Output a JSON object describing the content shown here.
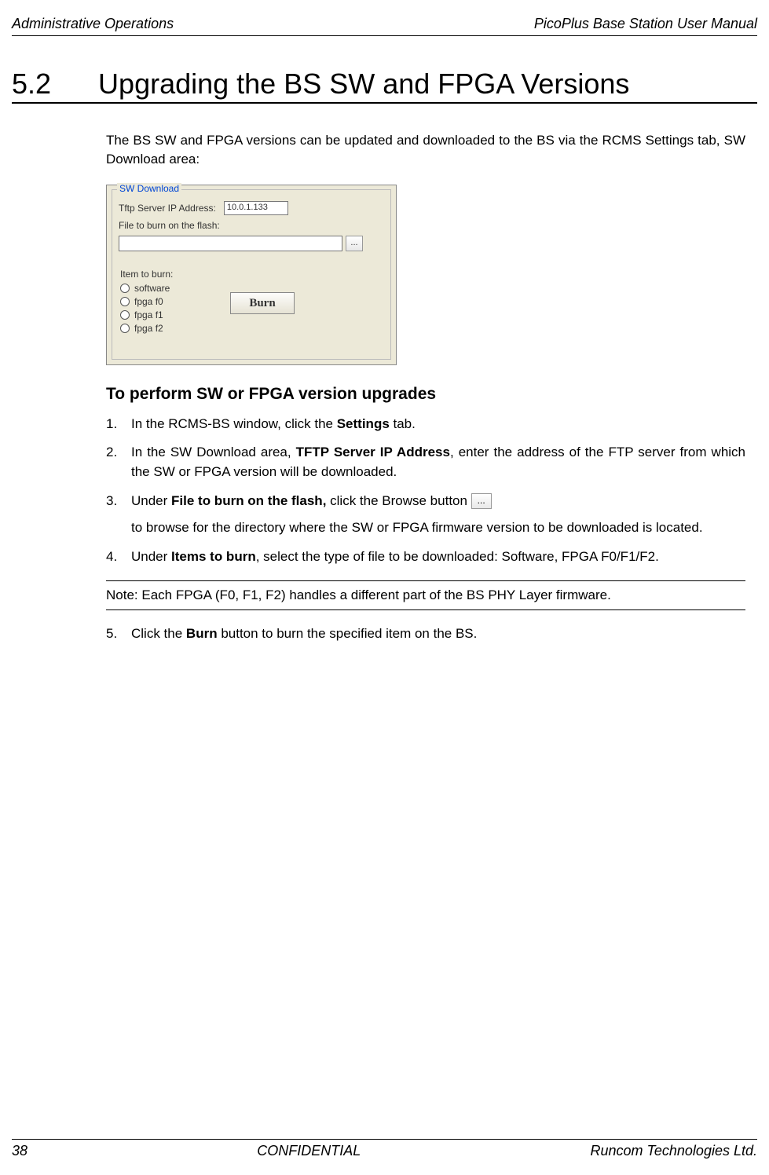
{
  "header": {
    "left": "Administrative Operations",
    "right": "PicoPlus Base Station User Manual"
  },
  "section": {
    "number": "5.2",
    "title": "Upgrading the BS SW and FPGA Versions"
  },
  "intro": "The BS SW and FPGA versions can be updated and downloaded to the BS via the RCMS Settings tab, SW Download area:",
  "screenshot": {
    "group_label": "SW Download",
    "tftp_label": "Tftp Server IP Address:",
    "tftp_value": "10.0.1.133",
    "file_label": "File to burn on the flash:",
    "file_value": "",
    "browse_label": "...",
    "item_label": "Item to burn:",
    "radios": [
      "software",
      "fpga f0",
      "fpga f1",
      "fpga f2"
    ],
    "burn_label": "Burn"
  },
  "subheading": "To perform SW or FPGA version upgrades",
  "steps": {
    "s1": {
      "num": "1.",
      "pre": "In the RCMS-BS window, click the ",
      "bold": "Settings",
      "post": " tab."
    },
    "s2": {
      "num": "2.",
      "pre": "In the SW Download area, ",
      "bold": "TFTP Server IP Address",
      "post": ", enter the address of the FTP server from which the SW or FPGA version will be downloaded."
    },
    "s3": {
      "num": "3.",
      "pre": "Under ",
      "bold": "File to burn on the flash,",
      "post": " click the Browse button ",
      "browse": "...",
      "sub": "to browse for the directory where the SW or FPGA firmware version to be downloaded is located."
    },
    "s4": {
      "num": "4.",
      "pre": "Under ",
      "bold": "Items to burn",
      "post": ", select the type of file to be downloaded: Software, FPGA F0/F1/F2."
    },
    "s5": {
      "num": "5.",
      "pre": "Click the ",
      "bold": "Burn",
      "post": " button to burn the specified item on the BS."
    }
  },
  "note": "Note: Each FPGA (F0, F1, F2) handles a different part of the BS PHY Layer firmware.",
  "footer": {
    "left": "38",
    "center": "CONFIDENTIAL",
    "right": "Runcom Technologies Ltd."
  }
}
